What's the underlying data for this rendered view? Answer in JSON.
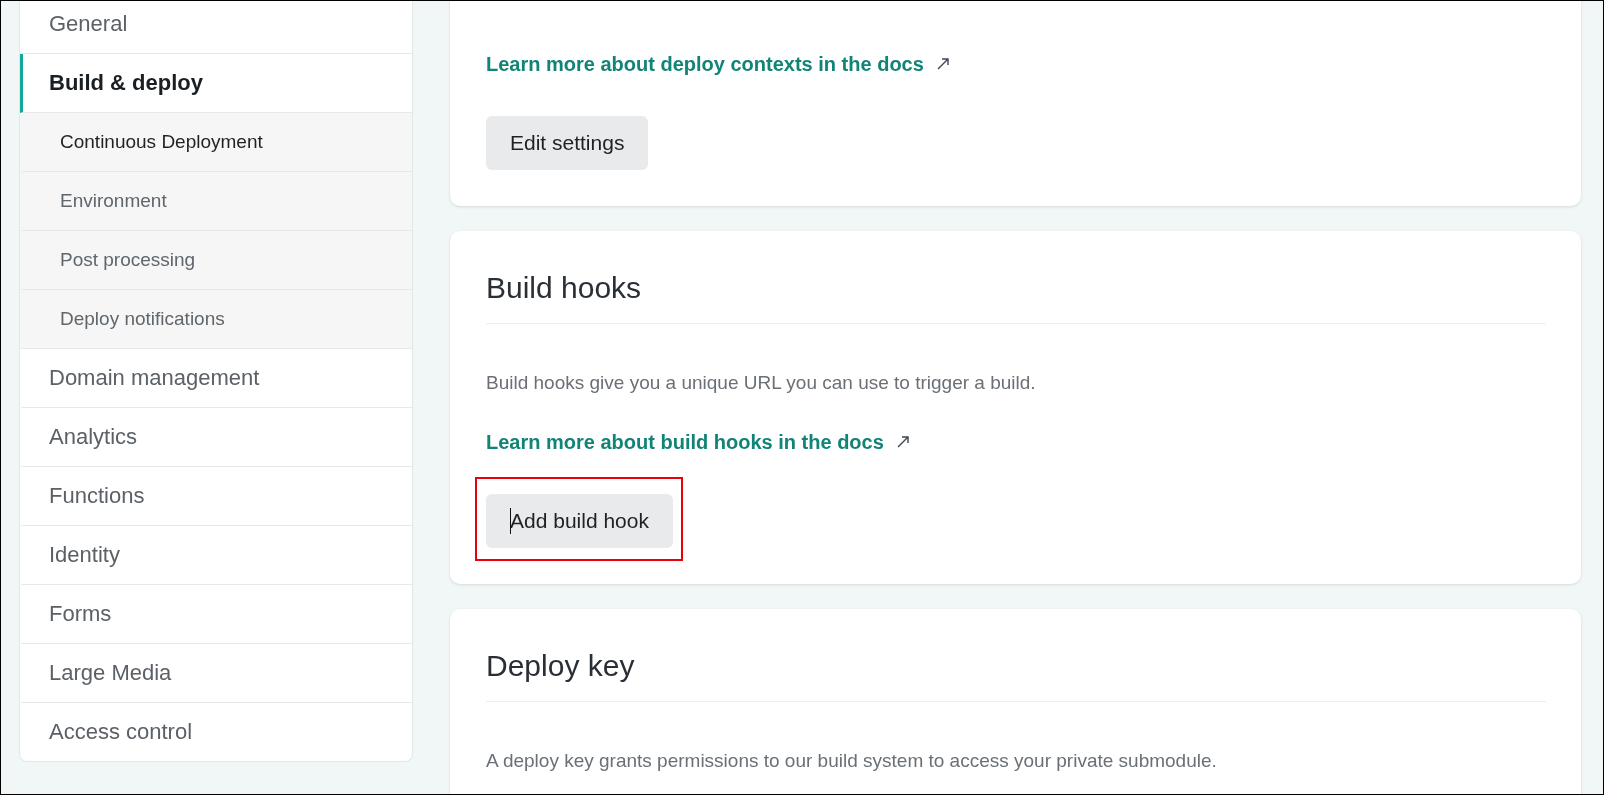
{
  "sidebar": {
    "items": [
      {
        "label": "General",
        "kind": "section",
        "selected": false
      },
      {
        "label": "Build & deploy",
        "kind": "section",
        "selected": true
      },
      {
        "label": "Continuous Deployment",
        "kind": "subsection",
        "selected": true
      },
      {
        "label": "Environment",
        "kind": "subsection",
        "selected": false
      },
      {
        "label": "Post processing",
        "kind": "subsection",
        "selected": false
      },
      {
        "label": "Deploy notifications",
        "kind": "subsection",
        "selected": false
      },
      {
        "label": "Domain management",
        "kind": "section",
        "selected": false
      },
      {
        "label": "Analytics",
        "kind": "section",
        "selected": false
      },
      {
        "label": "Functions",
        "kind": "section",
        "selected": false
      },
      {
        "label": "Identity",
        "kind": "section",
        "selected": false
      },
      {
        "label": "Forms",
        "kind": "section",
        "selected": false
      },
      {
        "label": "Large Media",
        "kind": "section",
        "selected": false
      },
      {
        "label": "Access control",
        "kind": "section",
        "selected": false
      }
    ]
  },
  "cards": [
    {
      "link": "Learn more about deploy contexts in the docs",
      "button": "Edit settings",
      "button_highlighted": false
    },
    {
      "title": "Build hooks",
      "description": "Build hooks give you a unique URL you can use to trigger a build.",
      "link": "Learn more about build hooks in the docs",
      "button": "Add build hook",
      "button_highlighted": true
    },
    {
      "title": "Deploy key",
      "description": "A deploy key grants permissions to our build system to access your private submodule."
    }
  ]
}
